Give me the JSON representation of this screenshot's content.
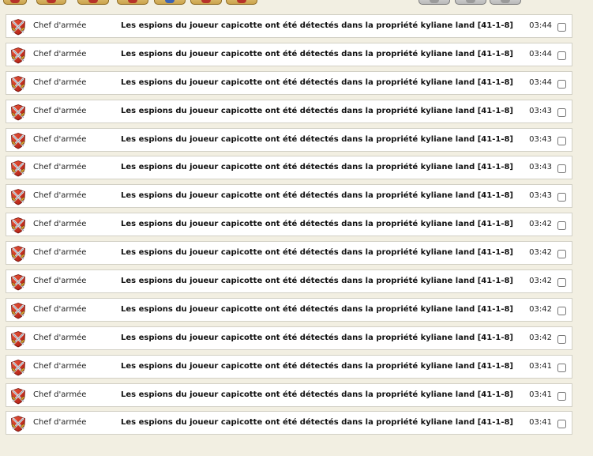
{
  "toolbar": {
    "left_tabs": [
      {
        "icon": "category-tab-icon"
      },
      {
        "icon": "category-tab-icon"
      },
      {
        "icon": "category-tab-icon"
      },
      {
        "icon": "category-tab-icon"
      },
      {
        "icon": "category-tab-icon"
      },
      {
        "icon": "category-tab-icon"
      },
      {
        "icon": "category-tab-icon"
      }
    ],
    "right_tabs": [
      {
        "icon": "action-tab-icon"
      },
      {
        "icon": "action-tab-icon"
      },
      {
        "icon": "action-tab-icon"
      }
    ]
  },
  "messages": [
    {
      "icon": "crossed-swords-icon",
      "sender": "Chef d'armée",
      "subject": "Les espions du joueur capicotte ont été détectés dans la propriété kyliane land [41-1-8]",
      "time": "03:44",
      "checked": false
    },
    {
      "icon": "crossed-swords-icon",
      "sender": "Chef d'armée",
      "subject": "Les espions du joueur capicotte ont été détectés dans la propriété kyliane land [41-1-8]",
      "time": "03:44",
      "checked": false
    },
    {
      "icon": "crossed-swords-icon",
      "sender": "Chef d'armée",
      "subject": "Les espions du joueur capicotte ont été détectés dans la propriété kyliane land [41-1-8]",
      "time": "03:44",
      "checked": false
    },
    {
      "icon": "crossed-swords-icon",
      "sender": "Chef d'armée",
      "subject": "Les espions du joueur capicotte ont été détectés dans la propriété kyliane land [41-1-8]",
      "time": "03:43",
      "checked": false
    },
    {
      "icon": "crossed-swords-icon",
      "sender": "Chef d'armée",
      "subject": "Les espions du joueur capicotte ont été détectés dans la propriété kyliane land [41-1-8]",
      "time": "03:43",
      "checked": false
    },
    {
      "icon": "crossed-swords-icon",
      "sender": "Chef d'armée",
      "subject": "Les espions du joueur capicotte ont été détectés dans la propriété kyliane land [41-1-8]",
      "time": "03:43",
      "checked": false
    },
    {
      "icon": "crossed-swords-icon",
      "sender": "Chef d'armée",
      "subject": "Les espions du joueur capicotte ont été détectés dans la propriété kyliane land [41-1-8]",
      "time": "03:43",
      "checked": false
    },
    {
      "icon": "crossed-swords-icon",
      "sender": "Chef d'armée",
      "subject": "Les espions du joueur capicotte ont été détectés dans la propriété kyliane land [41-1-8]",
      "time": "03:42",
      "checked": false
    },
    {
      "icon": "crossed-swords-icon",
      "sender": "Chef d'armée",
      "subject": "Les espions du joueur capicotte ont été détectés dans la propriété kyliane land [41-1-8]",
      "time": "03:42",
      "checked": false
    },
    {
      "icon": "crossed-swords-icon",
      "sender": "Chef d'armée",
      "subject": "Les espions du joueur capicotte ont été détectés dans la propriété kyliane land [41-1-8]",
      "time": "03:42",
      "checked": false
    },
    {
      "icon": "crossed-swords-icon",
      "sender": "Chef d'armée",
      "subject": "Les espions du joueur capicotte ont été détectés dans la propriété kyliane land [41-1-8]",
      "time": "03:42",
      "checked": false
    },
    {
      "icon": "crossed-swords-icon",
      "sender": "Chef d'armée",
      "subject": "Les espions du joueur capicotte ont été détectés dans la propriété kyliane land [41-1-8]",
      "time": "03:42",
      "checked": false
    },
    {
      "icon": "crossed-swords-icon",
      "sender": "Chef d'armée",
      "subject": "Les espions du joueur capicotte ont été détectés dans la propriété kyliane land [41-1-8]",
      "time": "03:41",
      "checked": false
    },
    {
      "icon": "crossed-swords-icon",
      "sender": "Chef d'armée",
      "subject": "Les espions du joueur capicotte ont été détectés dans la propriété kyliane land [41-1-8]",
      "time": "03:41",
      "checked": false
    },
    {
      "icon": "crossed-swords-icon",
      "sender": "Chef d'armée",
      "subject": "Les espions du joueur capicotte ont été détectés dans la propriété kyliane land [41-1-8]",
      "time": "03:41",
      "checked": false
    }
  ]
}
